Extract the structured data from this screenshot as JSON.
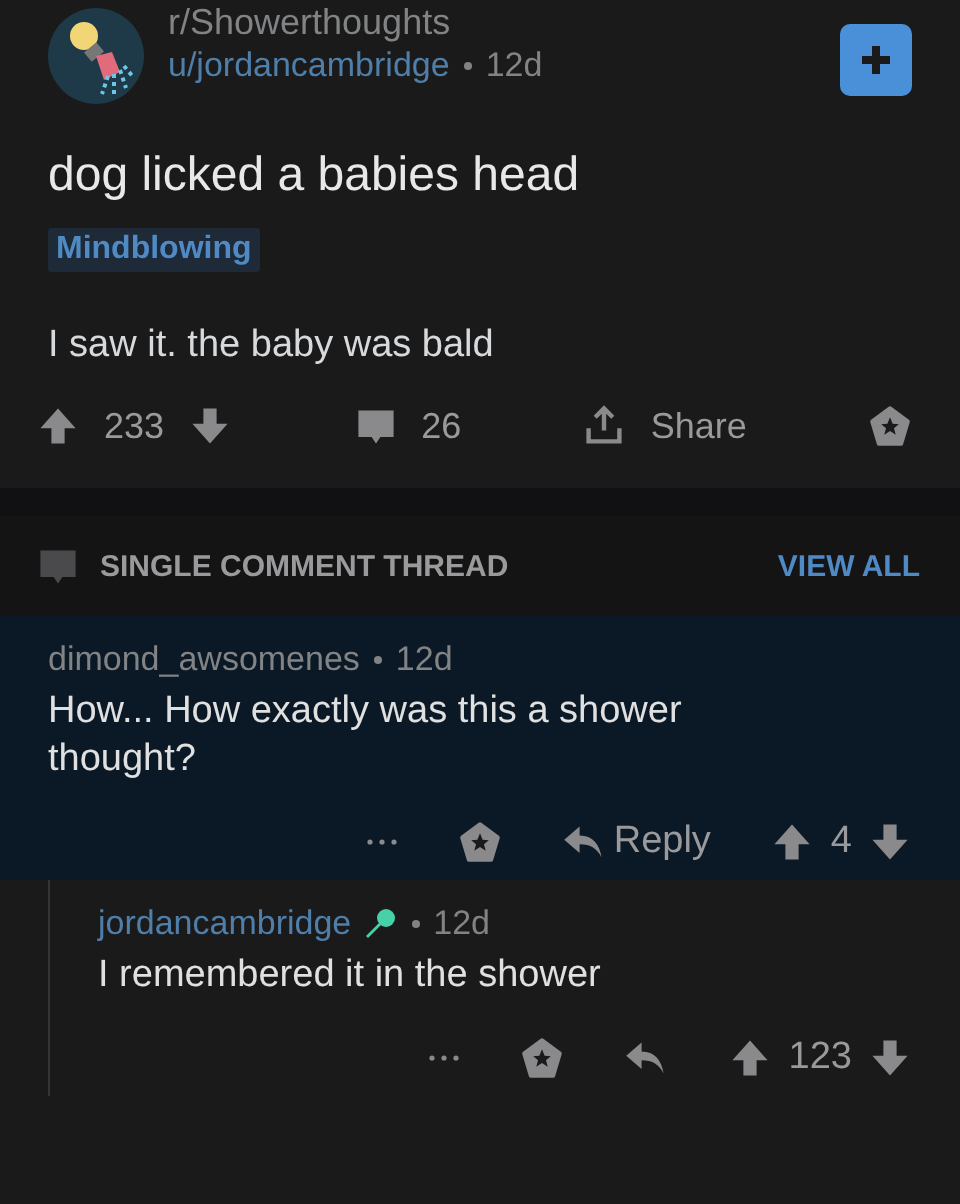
{
  "post": {
    "subreddit": "r/Showerthoughts",
    "author": "u/jordancambridge",
    "age": "12d",
    "title": "dog licked a babies head",
    "flair": "Mindblowing",
    "body": "I saw it. the baby was bald",
    "score": "233",
    "comments": "26",
    "share": "Share"
  },
  "thread": {
    "label": "SINGLE COMMENT THREAD",
    "view_all": "VIEW ALL"
  },
  "comments": [
    {
      "author": "dimond_awsomenes",
      "age": "12d",
      "text": "How... How exactly was this a shower thought?",
      "reply": "Reply",
      "score": "4",
      "highlighted": true,
      "op": false,
      "children": [
        {
          "author": "jordancambridge",
          "age": "12d",
          "text": "I remembered it in the shower",
          "score": "123",
          "highlighted": false,
          "op": true
        }
      ]
    }
  ]
}
